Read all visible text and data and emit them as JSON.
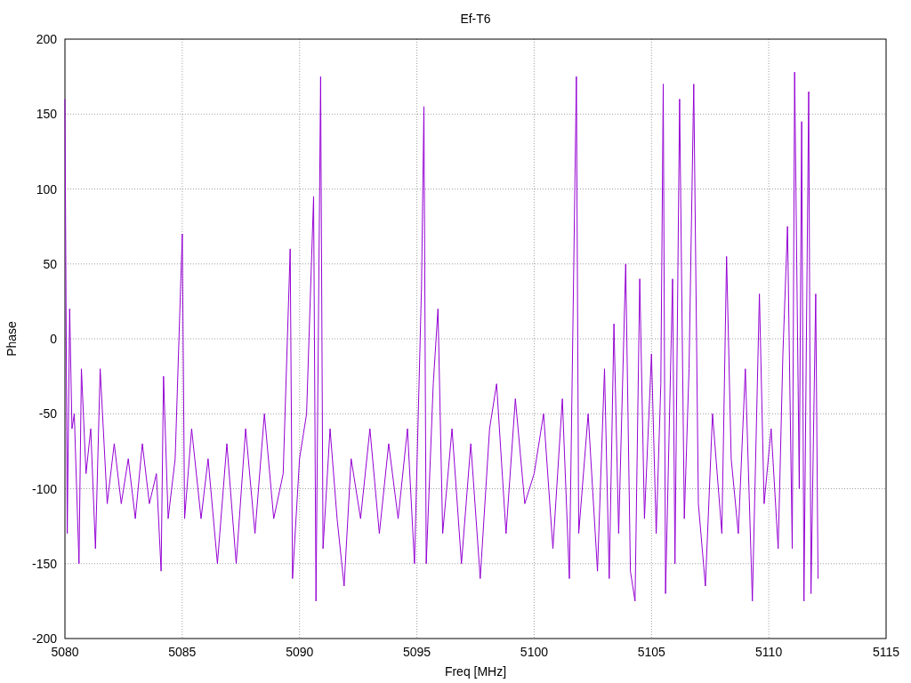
{
  "plot": {
    "chart_data": {
      "type": "line",
      "title": "Ef-T6",
      "xlabel": "Freq [MHz]",
      "ylabel": "Phase",
      "grid": true,
      "xlim": [
        5080,
        5115
      ],
      "ylim": [
        -200,
        200
      ],
      "xticks": [
        5080,
        5085,
        5090,
        5095,
        5100,
        5105,
        5110,
        5115
      ],
      "yticks": [
        -200,
        -150,
        -100,
        -50,
        0,
        50,
        100,
        150,
        200
      ],
      "x": [
        5080.0,
        5080.1,
        5080.2,
        5080.3,
        5080.4,
        5080.6,
        5080.7,
        5080.9,
        5081.1,
        5081.3,
        5081.5,
        5081.8,
        5082.1,
        5082.4,
        5082.7,
        5083.0,
        5083.3,
        5083.6,
        5083.9,
        5084.1,
        5084.2,
        5084.4,
        5084.7,
        5085.0,
        5085.1,
        5085.4,
        5085.8,
        5086.1,
        5086.5,
        5086.9,
        5087.3,
        5087.7,
        5088.1,
        5088.5,
        5088.9,
        5089.3,
        5089.6,
        5089.7,
        5090.0,
        5090.3,
        5090.6,
        5090.7,
        5090.9,
        5091.0,
        5091.3,
        5091.6,
        5091.9,
        5092.2,
        5092.6,
        5093.0,
        5093.4,
        5093.8,
        5094.2,
        5094.6,
        5094.9,
        5095.2,
        5095.3,
        5095.4,
        5095.7,
        5095.9,
        5096.1,
        5096.5,
        5096.9,
        5097.3,
        5097.7,
        5098.1,
        5098.4,
        5098.8,
        5099.2,
        5099.6,
        5100.0,
        5100.4,
        5100.8,
        5101.2,
        5101.5,
        5101.8,
        5101.9,
        5102.3,
        5102.7,
        5103.0,
        5103.2,
        5103.4,
        5103.6,
        5103.9,
        5104.1,
        5104.3,
        5104.5,
        5104.7,
        5105.0,
        5105.2,
        5105.4,
        5105.5,
        5105.6,
        5105.9,
        5106.0,
        5106.2,
        5106.4,
        5106.6,
        5106.8,
        5107.0,
        5107.3,
        5107.6,
        5108.0,
        5108.2,
        5108.4,
        5108.7,
        5109.0,
        5109.3,
        5109.6,
        5109.8,
        5110.1,
        5110.4,
        5110.6,
        5110.8,
        5111.0,
        5111.1,
        5111.3,
        5111.4,
        5111.5,
        5111.7,
        5111.8,
        5112.0,
        5112.1
      ],
      "series": [
        {
          "color": "#9400d3",
          "values": [
            160,
            -130,
            20,
            -60,
            -50,
            -150,
            -20,
            -90,
            -60,
            -140,
            -20,
            -110,
            -70,
            -110,
            -80,
            -120,
            -70,
            -110,
            -90,
            -155,
            -25,
            -120,
            -80,
            70,
            -120,
            -60,
            -120,
            -80,
            -150,
            -70,
            -150,
            -60,
            -130,
            -50,
            -120,
            -90,
            60,
            -160,
            -80,
            -50,
            95,
            -175,
            175,
            -140,
            -60,
            -120,
            -165,
            -80,
            -120,
            -60,
            -130,
            -70,
            -120,
            -60,
            -150,
            35,
            155,
            -150,
            -30,
            20,
            -130,
            -60,
            -150,
            -70,
            -160,
            -60,
            -30,
            -130,
            -40,
            -110,
            -90,
            -50,
            -140,
            -40,
            -160,
            175,
            -130,
            -50,
            -155,
            -20,
            -160,
            10,
            -130,
            50,
            -155,
            -175,
            40,
            -120,
            -10,
            -130,
            -30,
            170,
            -170,
            40,
            -150,
            160,
            -120,
            -20,
            170,
            -110,
            -165,
            -50,
            -130,
            55,
            -80,
            -130,
            -20,
            -175,
            30,
            -110,
            -60,
            -140,
            -10,
            75,
            -140,
            178,
            -100,
            145,
            -175,
            165,
            -170,
            30,
            -160
          ]
        }
      ]
    }
  }
}
